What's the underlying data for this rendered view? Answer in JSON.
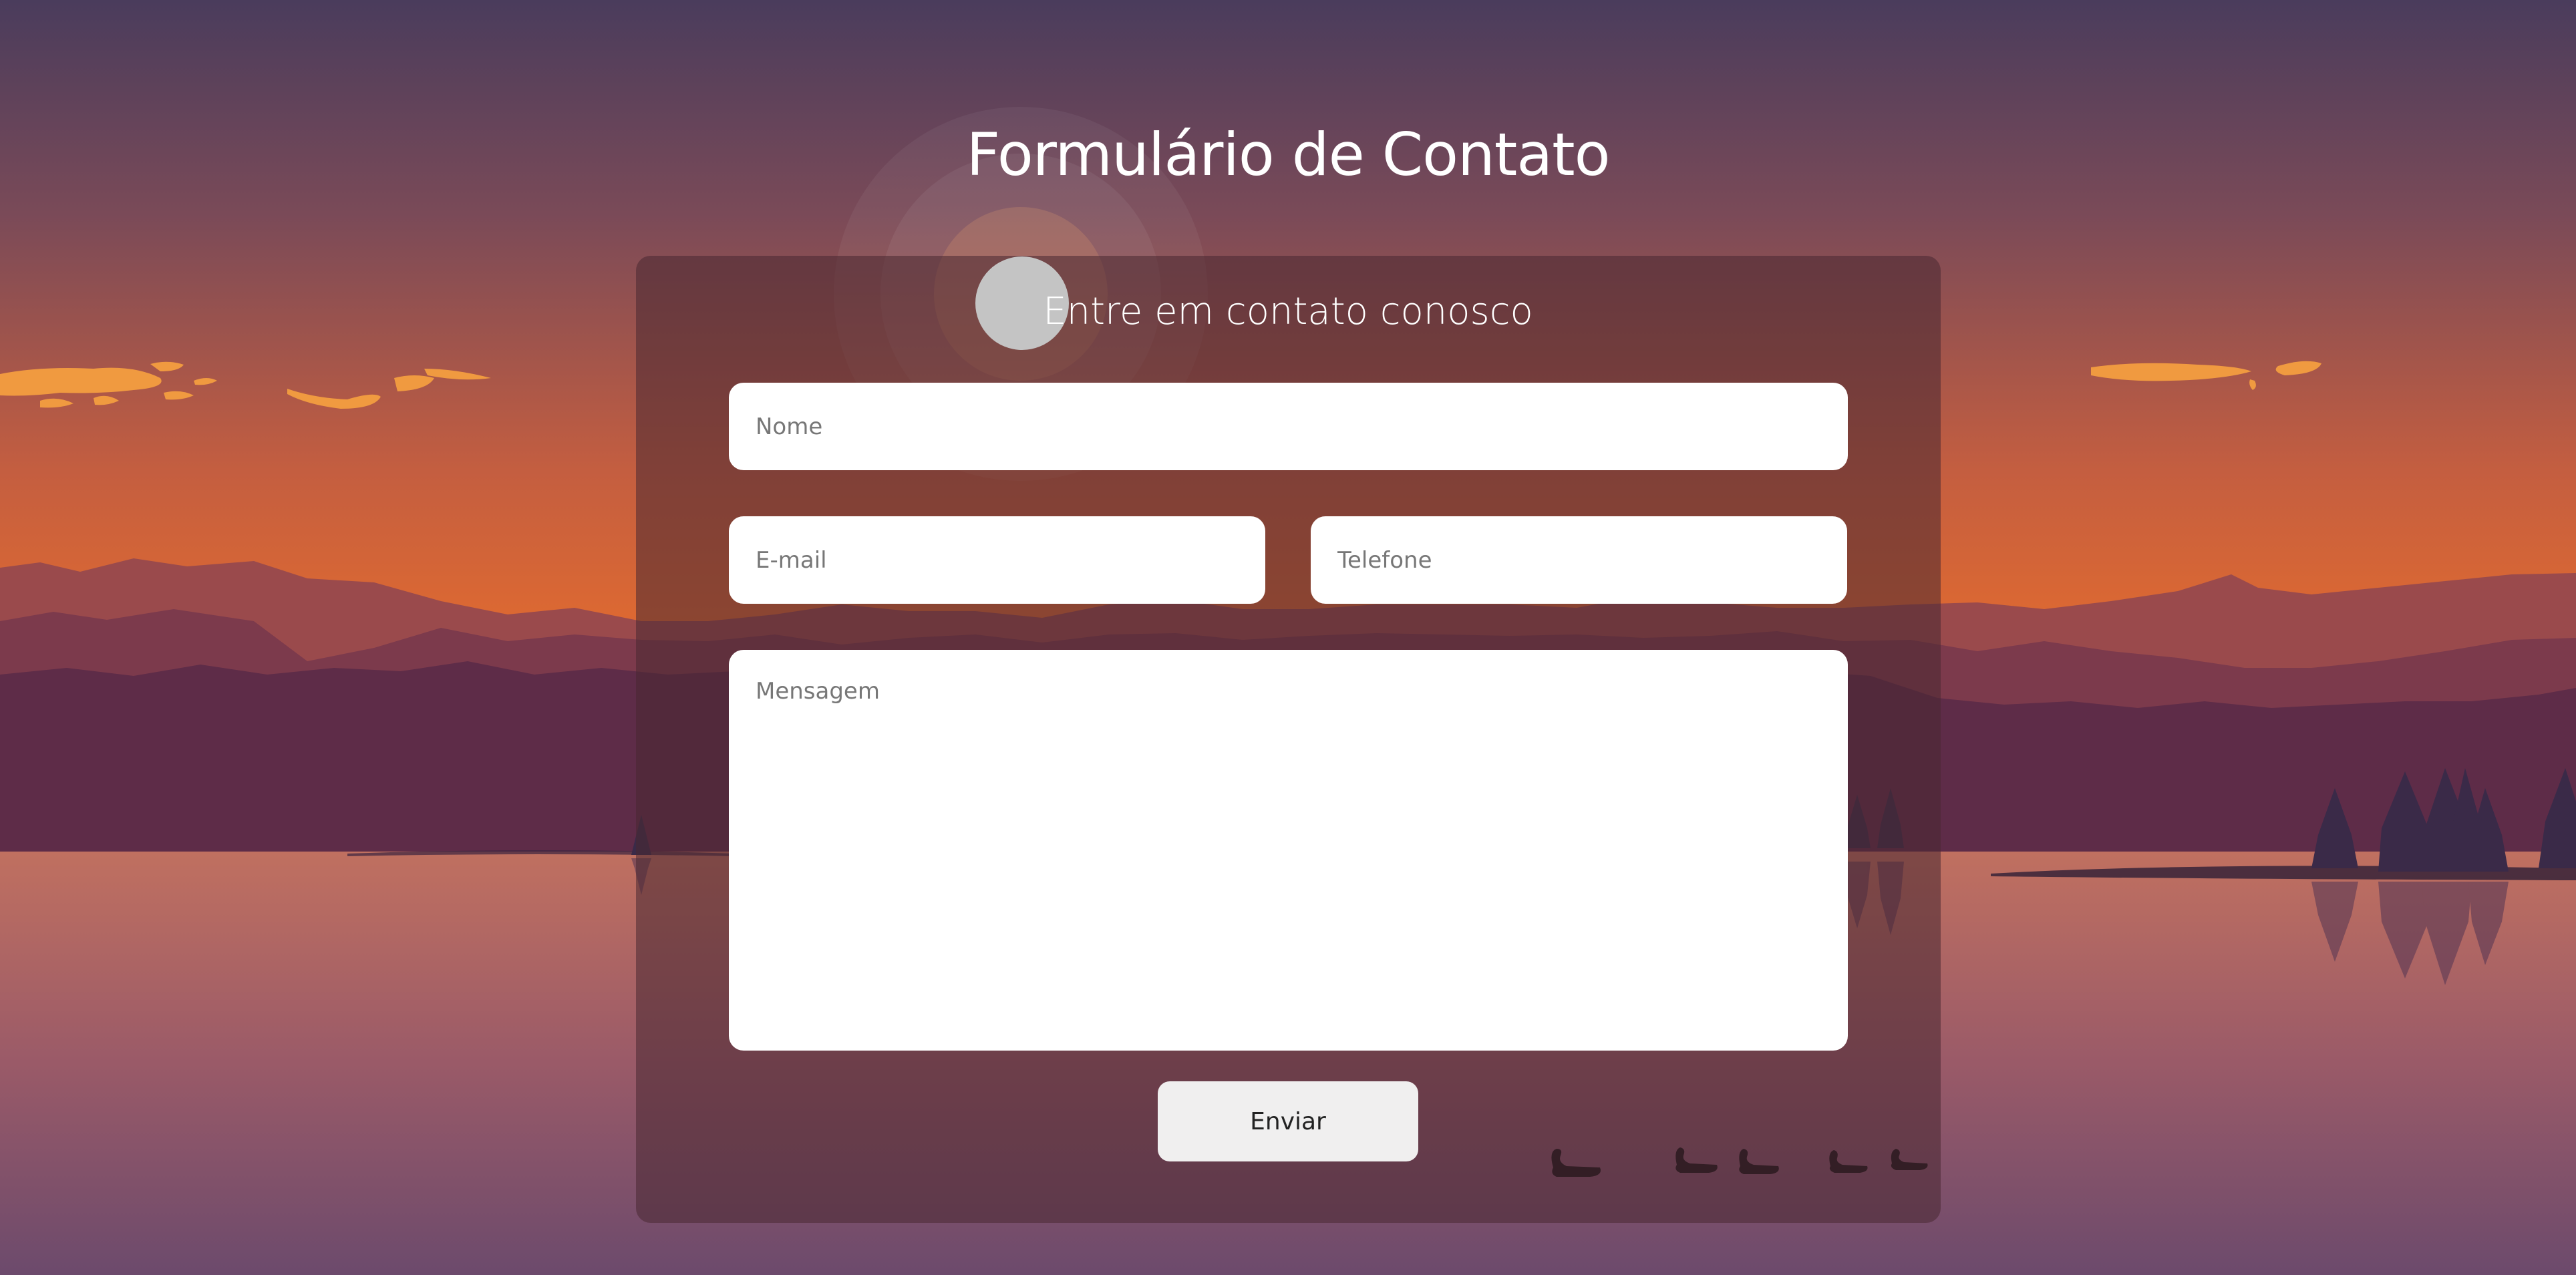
{
  "page": {
    "title": "Formulário de Contato"
  },
  "form": {
    "subtitle": "Entre em contato conosco",
    "fields": {
      "name_placeholder": "Nome",
      "email_placeholder": "E-mail",
      "phone_placeholder": "Telefone",
      "message_placeholder": "Mensagem"
    },
    "submit_label": "Enviar"
  },
  "colors": {
    "sky_top": "#4a3c5c",
    "sky_horizon": "#e06a30",
    "cloud": "#f09a40",
    "mountain_far": "#9a4a4c",
    "mountain_near": "#5e2c48",
    "water_top": "#c07060",
    "water_bottom": "#6c4a6c",
    "card_overlay": "#482832",
    "avatar": "#c4c4c4",
    "button_bg": "#f0efef"
  },
  "background": {
    "scene": "sunset lake landscape",
    "icons": [
      "sun-icon",
      "cloud-icon",
      "mountain-icon",
      "pine-tree-icon",
      "swan-icon"
    ]
  }
}
